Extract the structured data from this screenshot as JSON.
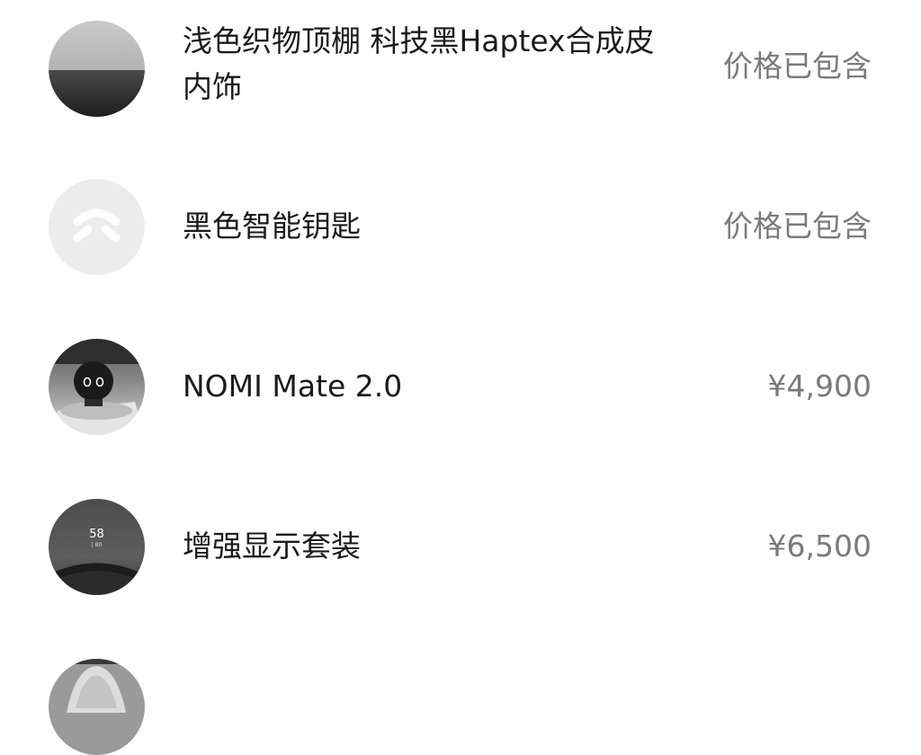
{
  "options": [
    {
      "name": "浅色织物顶棚 科技黑Haptex合成皮内饰",
      "price": "价格已包含",
      "icon": "interior-swatch-thumbnail"
    },
    {
      "name": "黑色智能钥匙",
      "price": "价格已包含",
      "icon": "nio-logo-key-thumbnail"
    },
    {
      "name": "NOMI Mate 2.0",
      "price": "¥4,900",
      "icon": "nomi-robot-thumbnail"
    },
    {
      "name": "增强显示套装",
      "price": "¥6,500",
      "icon": "hud-display-thumbnail",
      "hud_speed": "58",
      "hud_sub": "| 80"
    },
    {
      "name": "",
      "price": "",
      "icon": "seat-thumbnail"
    }
  ]
}
